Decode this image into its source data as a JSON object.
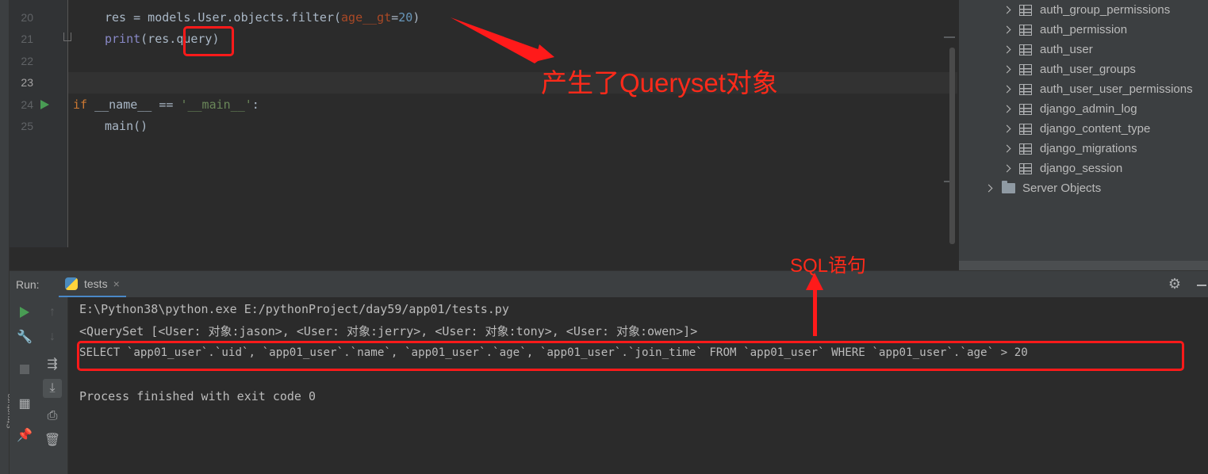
{
  "editor": {
    "line_numbers": [
      "20",
      "21",
      "22",
      "23",
      "24",
      "25"
    ],
    "code": {
      "l20_a": "res = models.User.objects.filter(",
      "l20_param": "age__gt",
      "l20_eq": "=",
      "l20_num": "20",
      "l20_close": ")",
      "l21_print": "print",
      "l21_a": "(res.",
      "l21_query": "query",
      "l21_close": ")",
      "l24_if": "if",
      "l24_a": " __name__ == ",
      "l24_str": "'__main__'",
      "l24_colon": ":",
      "l25": "main()"
    }
  },
  "database": {
    "tables": [
      "auth_group_permissions",
      "auth_permission",
      "auth_user",
      "auth_user_groups",
      "auth_user_user_permissions",
      "django_admin_log",
      "django_content_type",
      "django_migrations",
      "django_session"
    ],
    "server_objects": "Server Objects"
  },
  "run_panel": {
    "title": "Run:",
    "tab_label": "tests",
    "tab_close": "×",
    "structure_label": "Structure",
    "console": [
      "E:\\Python38\\python.exe E:/pythonProject/day59/app01/tests.py",
      "<QuerySet [<User: 对象:jason>, <User: 对象:jerry>, <User: 对象:tony>, <User: 对象:owen>]>",
      "SELECT `app01_user`.`uid`, `app01_user`.`name`, `app01_user`.`age`, `app01_user`.`join_time` FROM `app01_user` WHERE `app01_user`.`age` > 20",
      "",
      "Process finished with exit code 0"
    ]
  },
  "annotations": {
    "queryset_note": "产生了Queryset对象",
    "sql_note": "SQL语句",
    "color": "#ff1a1a"
  },
  "colors": {
    "editor_bg": "#2b2b2b",
    "panel_bg": "#3c3f41",
    "keyword": "#cc7832",
    "string": "#6a8759",
    "number": "#6897bb"
  }
}
